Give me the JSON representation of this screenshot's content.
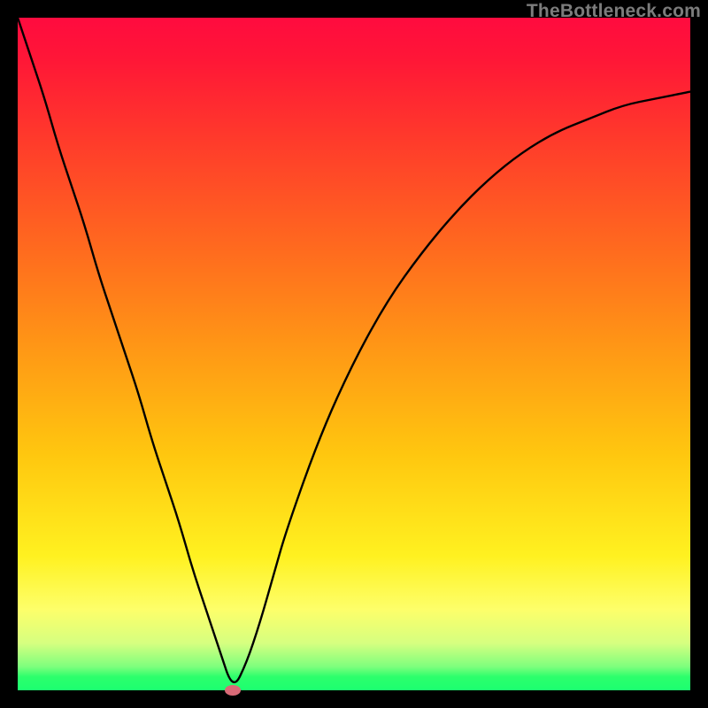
{
  "attribution": "TheBottleneck.com",
  "colors": {
    "frame": "#000000",
    "curve": "#000000",
    "marker": "#d96a77"
  },
  "chart_data": {
    "type": "line",
    "title": "",
    "xlabel": "",
    "ylabel": "",
    "xlim": [
      0,
      100
    ],
    "ylim": [
      0,
      100
    ],
    "x": [
      0,
      2,
      4,
      6,
      8,
      10,
      12,
      14,
      16,
      18,
      20,
      22,
      24,
      26,
      28,
      30,
      32,
      34,
      36,
      38,
      40,
      45,
      50,
      55,
      60,
      65,
      70,
      75,
      80,
      85,
      90,
      95,
      100
    ],
    "values": [
      100,
      94,
      88,
      81,
      75,
      69,
      62,
      56,
      50,
      44,
      37,
      31,
      25,
      18,
      12,
      6,
      0,
      4,
      10,
      17,
      24,
      38,
      49,
      58,
      65,
      71,
      76,
      80,
      83,
      85,
      87,
      88,
      89
    ],
    "minimum": {
      "x": 32,
      "y": 0
    },
    "grid": false,
    "legend": false
  }
}
